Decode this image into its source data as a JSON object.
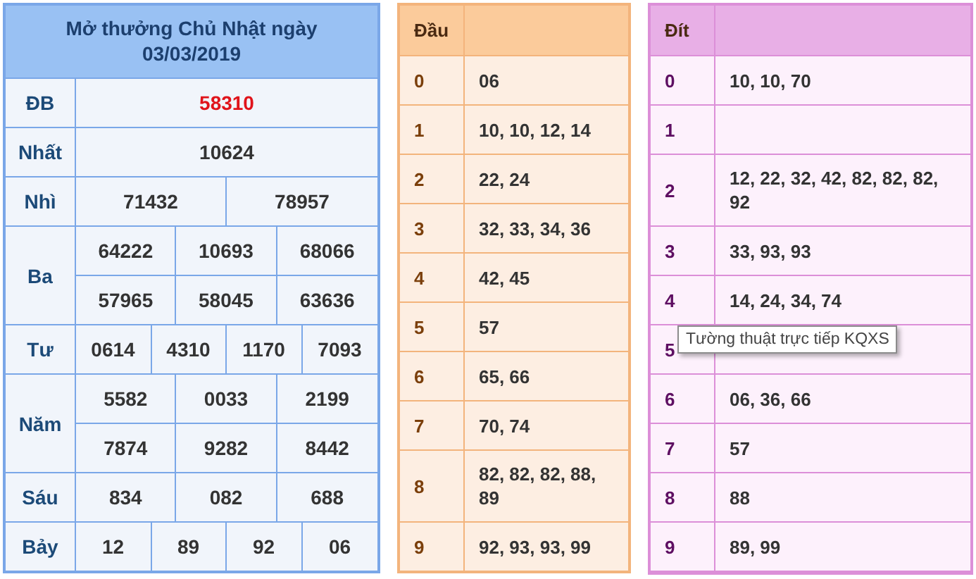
{
  "results": {
    "title": "Mở thưởng Chủ Nhật ngày 03/03/2019",
    "prizes": [
      {
        "label": "ĐB",
        "highlight": true,
        "rows": [
          [
            "58310"
          ]
        ]
      },
      {
        "label": "Nhất",
        "highlight": false,
        "rows": [
          [
            "10624"
          ]
        ]
      },
      {
        "label": "Nhì",
        "highlight": false,
        "rows": [
          [
            "71432",
            "78957"
          ]
        ]
      },
      {
        "label": "Ba",
        "highlight": false,
        "rows": [
          [
            "64222",
            "10693",
            "68066"
          ],
          [
            "57965",
            "58045",
            "63636"
          ]
        ]
      },
      {
        "label": "Tư",
        "highlight": false,
        "rows": [
          [
            "0614",
            "4310",
            "1170",
            "7093"
          ]
        ]
      },
      {
        "label": "Năm",
        "highlight": false,
        "rows": [
          [
            "5582",
            "0033",
            "2199"
          ],
          [
            "7874",
            "9282",
            "8442"
          ]
        ]
      },
      {
        "label": "Sáu",
        "highlight": false,
        "rows": [
          [
            "834",
            "082",
            "688"
          ]
        ]
      },
      {
        "label": "Bảy",
        "highlight": false,
        "rows": [
          [
            "12",
            "89",
            "92",
            "06"
          ]
        ]
      }
    ]
  },
  "head_table": {
    "kind": "dau",
    "header": "Đầu",
    "rows": [
      {
        "digit": "0",
        "values": "06"
      },
      {
        "digit": "1",
        "values": "10, 10, 12, 14"
      },
      {
        "digit": "2",
        "values": "22, 24"
      },
      {
        "digit": "3",
        "values": "32, 33, 34, 36"
      },
      {
        "digit": "4",
        "values": "42, 45"
      },
      {
        "digit": "5",
        "values": "57"
      },
      {
        "digit": "6",
        "values": "65, 66"
      },
      {
        "digit": "7",
        "values": "70, 74"
      },
      {
        "digit": "8",
        "values": "82, 82, 82, 88, 89"
      },
      {
        "digit": "9",
        "values": "92, 93, 93, 99"
      }
    ]
  },
  "tail_table": {
    "kind": "dit",
    "header": "Đít",
    "rows": [
      {
        "digit": "0",
        "values": "10, 10, 70"
      },
      {
        "digit": "1"
      },
      {
        "digit": "2",
        "values": "12, 22, 32, 42, 82, 82, 82, 92"
      },
      {
        "digit": "3",
        "values": "33, 93, 93"
      },
      {
        "digit": "4",
        "values": "14, 24, 34, 74"
      },
      {
        "digit": "5"
      },
      {
        "digit": "6",
        "values": "06, 36, 66"
      },
      {
        "digit": "7",
        "values": "57"
      },
      {
        "digit": "8",
        "values": "88"
      },
      {
        "digit": "9",
        "values": "89, 99"
      }
    ]
  },
  "tooltip": {
    "text": "Tường thuật trực tiếp KQXS"
  }
}
